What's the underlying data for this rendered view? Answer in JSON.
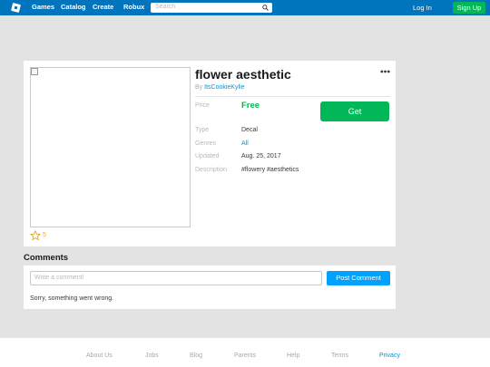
{
  "nav": {
    "links": [
      "Games",
      "Catalog",
      "Create",
      "Robux"
    ],
    "search_placeholder": "Search",
    "login": "Log In",
    "signup": "Sign Up"
  },
  "item": {
    "title": "flower aesthetic",
    "by_prefix": "By",
    "creator": "ItsCookieKylie",
    "price_label": "Price",
    "price": "Free",
    "get_button": "Get",
    "type_label": "Type",
    "type": "Decal",
    "genres_label": "Genres",
    "genres": "All",
    "updated_label": "Updated",
    "updated": "Aug. 25, 2017",
    "description_label": "Description",
    "description": "#flowery #aesthetics",
    "favorites": "5"
  },
  "comments": {
    "heading": "Comments",
    "placeholder": "Write a comment!",
    "post_button": "Post Comment",
    "error": "Sorry, something went wrong."
  },
  "footer": {
    "links": [
      "About Us",
      "Jobs",
      "Blog",
      "Parents",
      "Help",
      "Terms",
      "Privacy"
    ],
    "active": "Privacy"
  },
  "colors": {
    "nav_blue": "#0074bd",
    "green": "#02b757",
    "link_blue": "#0096d6",
    "button_blue": "#00a2ff",
    "star_gold": "#e2a72e"
  },
  "icons": [
    "roblox-logo-icon",
    "search-icon",
    "more-options-icon",
    "star-icon",
    "broken-image-icon"
  ]
}
